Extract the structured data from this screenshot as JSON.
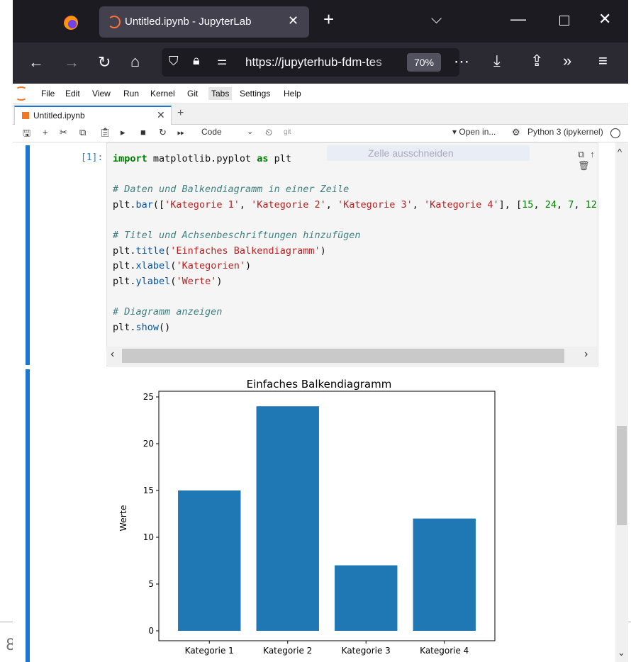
{
  "browser": {
    "tab_title": "Untitled.ipynb - JupyterLab",
    "url": "https://jupyterhub-fdm-tes",
    "zoom": "70%"
  },
  "menu": [
    "File",
    "Edit",
    "View",
    "Run",
    "Kernel",
    "Git",
    "Tabs",
    "Settings",
    "Help"
  ],
  "notebook_tab": "Untitled.ipynb",
  "toolbar": {
    "cell_type": "Code",
    "git_label": "git",
    "open_in": "▾ Open in...",
    "kernel": "Python 3 (ipykernel)"
  },
  "cell": {
    "prompt": "[1]:",
    "tooltip": "Zelle ausschneiden"
  },
  "chart_data": {
    "type": "bar",
    "title": "Einfaches Balkendiagramm",
    "xlabel": "",
    "ylabel": "Werte",
    "categories": [
      "Kategorie 1",
      "Kategorie 2",
      "Kategorie 3",
      "Kategorie 4"
    ],
    "values": [
      15,
      24,
      7,
      12
    ],
    "ylim": [
      0,
      25
    ],
    "yticks": [
      0,
      5,
      10,
      15,
      20,
      25
    ],
    "bar_color": "#1f77b4",
    "grid": false
  },
  "desktop_digit": "8"
}
